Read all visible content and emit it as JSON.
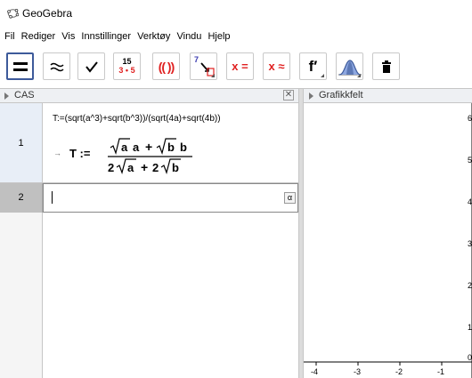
{
  "window": {
    "title": "GeoGebra"
  },
  "menu": [
    "Fil",
    "Rediger",
    "Vis",
    "Innstillinger",
    "Verktøy",
    "Vindu",
    "Hjelp"
  ],
  "toolbar": {
    "numeric_top": "15",
    "numeric_bottom": "3 • 5",
    "factor_label": "(( ))",
    "substitute_label": "7",
    "solve_label": "x =",
    "nsolve_label": "x ≈",
    "derivative_label": "f′"
  },
  "cas": {
    "header": "CAS",
    "close": "✕",
    "rows": [
      {
        "num": "1",
        "input": "T:=(sqrt(a^3)+sqrt(b^3))/(sqrt(4a)+sqrt(4b))",
        "output_lhs": "T :=",
        "num_a": "a",
        "num_b": "b",
        "den_two": "2",
        "den_two_b": "2",
        "plus": "+",
        "arrow": "→"
      },
      {
        "num": "2",
        "input": "",
        "alpha": "α"
      }
    ]
  },
  "graphics": {
    "header": "Grafikkfelt",
    "x_ticks": [
      "-4",
      "-3",
      "-2",
      "-1"
    ],
    "y_ticks": [
      "6",
      "5",
      "4",
      "3",
      "2",
      "1",
      "0"
    ]
  },
  "colors": {
    "selected_border": "#3d5a9a",
    "panel_header": "#eef0f3",
    "row_selected": "#c0c0c0",
    "red": "#e02020"
  }
}
